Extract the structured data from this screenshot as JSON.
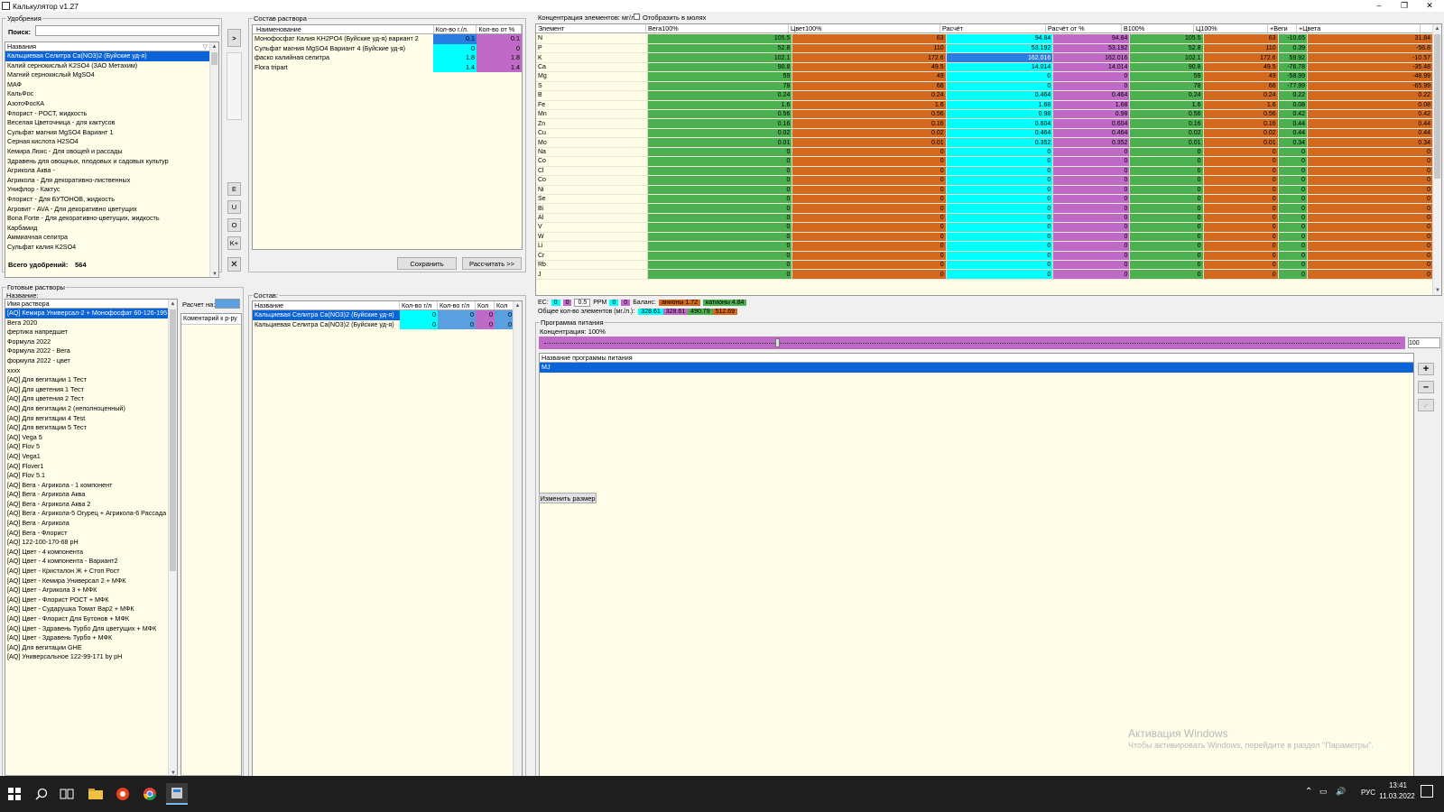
{
  "window": {
    "title": "Калькулятор v1.27",
    "min": "–",
    "max": "❐",
    "close": "✕"
  },
  "fertilizers": {
    "group_label": "Удобрения",
    "search_label": "Поиск:",
    "search_value": "",
    "column": "Названия",
    "items": [
      "Кальциевая Селитра Ca(NO3)2 (Буйские уд-я)",
      "Калий сернокислый K2SO4 (ЗАО Метахим)",
      "Магний сернокислый MgSO4",
      "МАФ",
      "КальФос",
      "АзотоФосКА",
      "Флорист - РОСТ, жидкость",
      "Веселая Цветочница - для кактусов",
      "Сульфат магния MgSO4 Вариант 1",
      "Серная кислота H2SO4",
      "Кемира Люкс - Для овощей и рассады",
      "Здравень для овощных, плодовых и садовых культур",
      "Агрикола Аква -",
      "Агрикола - Для декоративно-лиственных",
      "Унифлор - Кактус",
      "Флорист - Для БУТОНОВ, жидкость",
      "Агровит - AVA - Для декоративно цветущих",
      "Bona Forte - Для декоративно-цветущих, жидкость",
      "Карбамид",
      "Аммиачная селитра",
      "Сульфат калия K2SO4"
    ],
    "total_label": "Всего удобрений:",
    "total_value": "564"
  },
  "side_buttons": {
    "add": ">",
    "remove": "<",
    "e": "E",
    "u": "U",
    "o": "O",
    "k": "K+",
    "x": "✕"
  },
  "solution": {
    "group_label": "Состав раствора",
    "columns": [
      "Наименование",
      "Кол-во г./л.",
      "Кол-во от %"
    ],
    "rows": [
      {
        "name": "Монофосфат Калия KH2PO4 (Буйские уд-я) вариант 2",
        "g": "0.1",
        "pct": "0.1"
      },
      {
        "name": "Сульфат магния MgSO4 Вариант 4 (Буйские уд-я)",
        "g": "0",
        "pct": "0"
      },
      {
        "name": "фаско калийная селитра",
        "g": "1.8",
        "pct": "1.8"
      },
      {
        "name": "Flora tripart",
        "g": "1.4",
        "pct": "1.4"
      }
    ],
    "save": "Сохранить",
    "calc": "Рассчитать >>"
  },
  "concentration": {
    "label": "Концентрация элементов: мг/л.",
    "moles_label": "Отобразить в молях",
    "columns": [
      "Элемент",
      "Вега100%",
      "Цвет100%",
      "Расчёт",
      "Расчёт от %",
      "В100%",
      "Ц100%",
      "+Веги",
      "+Цвета"
    ],
    "rows": [
      [
        "N",
        "105.5",
        "63",
        "94.84",
        "94.84",
        "105.5",
        "63",
        "-10.65",
        "31.84"
      ],
      [
        "P",
        "52.8",
        "110",
        "53.192",
        "53.192",
        "52.8",
        "110",
        "0.39",
        "-56.8"
      ],
      [
        "K",
        "102.1",
        "172.6",
        "162.016",
        "162.016",
        "102.1",
        "172.6",
        "59.92",
        "-10.57"
      ],
      [
        "Ca",
        "90.8",
        "49.5",
        "14.014",
        "14.014",
        "90.8",
        "49.5",
        "-76.78",
        "-35.48"
      ],
      [
        "Mg",
        "59",
        "49",
        "0",
        "0",
        "59",
        "49",
        "-58.99",
        "-48.99"
      ],
      [
        "S",
        "78",
        "66",
        "0",
        "0",
        "78",
        "66",
        "-77.99",
        "-65.99"
      ],
      [
        "B",
        "0.24",
        "0.24",
        "0.464",
        "0.464",
        "0.24",
        "0.24",
        "0.22",
        "0.22"
      ],
      [
        "Fe",
        "1.6",
        "1.6",
        "1.68",
        "1.68",
        "1.6",
        "1.6",
        "0.08",
        "0.08"
      ],
      [
        "Mn",
        "0.56",
        "0.56",
        "0.98",
        "0.98",
        "0.56",
        "0.56",
        "0.42",
        "0.42"
      ],
      [
        "Zn",
        "0.16",
        "0.16",
        "0.604",
        "0.604",
        "0.16",
        "0.16",
        "0.44",
        "0.44"
      ],
      [
        "Cu",
        "0.02",
        "0.02",
        "0.464",
        "0.464",
        "0.02",
        "0.02",
        "0.44",
        "0.44"
      ],
      [
        "Mo",
        "0.01",
        "0.01",
        "0.352",
        "0.352",
        "0.01",
        "0.01",
        "0.34",
        "0.34"
      ],
      [
        "Na",
        "0",
        "0",
        "0",
        "0",
        "0",
        "0",
        "0",
        "0"
      ],
      [
        "Co",
        "0",
        "0",
        "0",
        "0",
        "0",
        "0",
        "0",
        "0"
      ],
      [
        "Cl",
        "0",
        "0",
        "0",
        "0",
        "0",
        "0",
        "0",
        "0"
      ],
      [
        "Co",
        "0",
        "0",
        "0",
        "0",
        "0",
        "0",
        "0",
        "0"
      ],
      [
        "Ni",
        "0",
        "0",
        "0",
        "0",
        "0",
        "0",
        "0",
        "0"
      ],
      [
        "Se",
        "0",
        "0",
        "0",
        "0",
        "0",
        "0",
        "0",
        "0"
      ],
      [
        "Bi",
        "0",
        "0",
        "0",
        "0",
        "0",
        "0",
        "0",
        "0"
      ],
      [
        "Al",
        "0",
        "0",
        "0",
        "0",
        "0",
        "0",
        "0",
        "0"
      ],
      [
        "V",
        "0",
        "0",
        "0",
        "0",
        "0",
        "0",
        "0",
        "0"
      ],
      [
        "W",
        "0",
        "0",
        "0",
        "0",
        "0",
        "0",
        "0",
        "0"
      ],
      [
        "Li",
        "0",
        "0",
        "0",
        "0",
        "0",
        "0",
        "0",
        "0"
      ],
      [
        "Cr",
        "0",
        "0",
        "0",
        "0",
        "0",
        "0",
        "0",
        "0"
      ],
      [
        "Rb",
        "0",
        "0",
        "0",
        "0",
        "0",
        "0",
        "0",
        "0"
      ],
      [
        "J",
        "0",
        "0",
        "0",
        "0",
        "0",
        "0",
        "0",
        "0"
      ]
    ],
    "ec_label": "EC:",
    "ec_values": [
      "0",
      "0",
      "0.5"
    ],
    "ppm_label": "PPM",
    "ppm_value": "0",
    "balance_label": "Баланс:",
    "anions": "анионы 1.72",
    "cations": "катионы 4.84",
    "total_label": "Общее кол-во элементов (мг./л.):",
    "totals": [
      "328.61",
      "328.61",
      "490.79",
      "512.69"
    ]
  },
  "ready": {
    "group_label": "Готовые растворы",
    "name_label": "Название:",
    "column": "Имя раствора",
    "items": [
      "[AQ] Кемира Универсал-2 + Монофосфат 60-126-195",
      "Вега 2020",
      "фертика напредшет",
      "Формула 2022",
      "Формула 2022 - Вега",
      "формула 2022 - цвет",
      "хххх",
      "[AQ] Для вегитации 1 Тест",
      "[AQ] Для цветения 1 Тест",
      "[AQ] Для цветения 2 Тест",
      "[AQ] Для вегитации 2 (неполноценный)",
      "[AQ] Для вегитации 4 Test",
      "[AQ] Для вегитации 5 Тест",
      "[AQ] Vega 5",
      "[AQ] Flov 5",
      "[AQ] Vega1",
      "[AQ] Flover1",
      "[AQ] Flov 5.1",
      "[AQ] Вега - Агрикола - 1 компонент",
      "[AQ] Вега - Агрикола Аква",
      "[AQ] Вега - Агрикола Аква 2",
      "[AQ] Вега - Агрикола-5 Огурец + Агрикола-6 Рассада",
      "[AQ] Вега - Агрикола",
      "[AQ] Вега - Флорист",
      "[AQ] 122-100-170-68 pH",
      "[AQ] Цвет - 4 компонента",
      "[AQ] Цвет - 4 компонента - Вариант2",
      "[AQ] Цвет - Кристалон Ж + Стоп Рост",
      "[AQ] Цвет - Кемира Универсал 2 + МФК",
      "[AQ] Цвет - Агрикола 3 + МФК",
      "[AQ] Цвет - Флорист РОСТ + МФК",
      "[AQ] Цвет - Сударушка Томат Вар2 + МФК",
      "[AQ] Цвет - Флорист Для Бутонов + МФК",
      "[AQ] Цвет - Здравень Турбо Для цветущих + МФК",
      "[AQ] Цвет - Здравень Турбо + МФК",
      "[AQ] Для вегитации GHE",
      "[AQ] Универсальное 122-99-171 by pH"
    ],
    "calc_for_label": "Расчет на:",
    "comment_label": "Коментарий к р-ру",
    "minus": "–"
  },
  "composition": {
    "group_label": "Состав:",
    "columns": [
      "Название",
      "Кол-во г/л",
      "Кол-во г/л",
      "Кол",
      "Кол"
    ],
    "rows": [
      {
        "name": "Кальциевая Селитра Ca(NO3)2 (Буйские уд-я)",
        "a": "0",
        "b": "0",
        "c": "0",
        "d": "0"
      },
      {
        "name": "Кальциевая Селитра Ca(NO3)2 (Буйские уд-я)",
        "a": "0",
        "b": "0",
        "c": "0",
        "d": "0"
      }
    ]
  },
  "program": {
    "group_label": "Программа питания",
    "conc_label": "Концентрация: 100%",
    "slider_value": "100",
    "slider_fraction": 0.27,
    "column": "Название программы питания",
    "items": [
      "MJ"
    ],
    "resize_btn": "Изменить размер",
    "plus": "+",
    "minus": "–"
  },
  "watermark": {
    "line1": "Активация Windows",
    "line2": "Чтобы активировать Windows, перейдите в раздел \"Параметры\"."
  },
  "taskbar": {
    "lang": "РУС",
    "time": "13:41",
    "date": "11.03.2022"
  },
  "colors": {
    "green": "#4caf50",
    "orange": "#d2691e",
    "cyan": "#00ffff",
    "magenta": "#c06ac8",
    "cream": "#fffce8",
    "select": "#0a64d8"
  }
}
